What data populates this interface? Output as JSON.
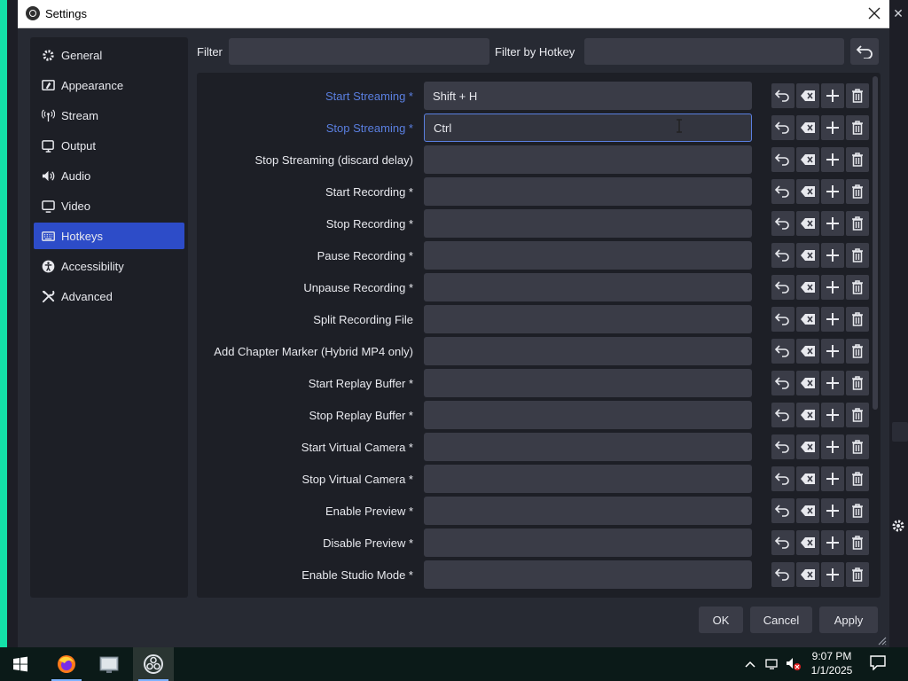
{
  "window": {
    "title": "Settings"
  },
  "sidebar": {
    "items": [
      {
        "label": "General",
        "icon": "gear-icon"
      },
      {
        "label": "Appearance",
        "icon": "appearance-icon"
      },
      {
        "label": "Stream",
        "icon": "antenna-icon"
      },
      {
        "label": "Output",
        "icon": "output-icon"
      },
      {
        "label": "Audio",
        "icon": "speaker-icon"
      },
      {
        "label": "Video",
        "icon": "monitor-icon"
      },
      {
        "label": "Hotkeys",
        "icon": "keyboard-icon",
        "active": true
      },
      {
        "label": "Accessibility",
        "icon": "accessibility-icon"
      },
      {
        "label": "Advanced",
        "icon": "wrench-icon"
      }
    ]
  },
  "filter": {
    "label": "Filter",
    "value": "",
    "hotkey_label": "Filter by Hotkey",
    "hotkey_value": ""
  },
  "hotkeys": [
    {
      "label": "Start Streaming *",
      "value": "Shift + H",
      "modified": true
    },
    {
      "label": "Stop Streaming *",
      "value": "Ctrl",
      "modified": true,
      "focused": true
    },
    {
      "label": "Stop Streaming (discard delay)",
      "value": ""
    },
    {
      "label": "Start Recording *",
      "value": ""
    },
    {
      "label": "Stop Recording *",
      "value": ""
    },
    {
      "label": "Pause Recording *",
      "value": ""
    },
    {
      "label": "Unpause Recording *",
      "value": ""
    },
    {
      "label": "Split Recording File",
      "value": ""
    },
    {
      "label": "Add Chapter Marker (Hybrid MP4 only)",
      "value": ""
    },
    {
      "label": "Start Replay Buffer *",
      "value": ""
    },
    {
      "label": "Stop Replay Buffer *",
      "value": ""
    },
    {
      "label": "Start Virtual Camera *",
      "value": ""
    },
    {
      "label": "Stop Virtual Camera *",
      "value": ""
    },
    {
      "label": "Enable Preview *",
      "value": ""
    },
    {
      "label": "Disable Preview *",
      "value": ""
    },
    {
      "label": "Enable Studio Mode *",
      "value": ""
    }
  ],
  "buttons": {
    "ok": "OK",
    "cancel": "Cancel",
    "apply": "Apply"
  },
  "taskbar": {
    "apps": [
      "windows-start-icon",
      "firefox-icon",
      "file-explorer-icon",
      "obs-icon"
    ],
    "time": "9:07 PM",
    "date": "1/1/2025"
  },
  "colors": {
    "accent": "#2d4cc8",
    "modified_label": "#5a7fe0",
    "panel": "#1d1f26",
    "field": "#3a3c47"
  }
}
